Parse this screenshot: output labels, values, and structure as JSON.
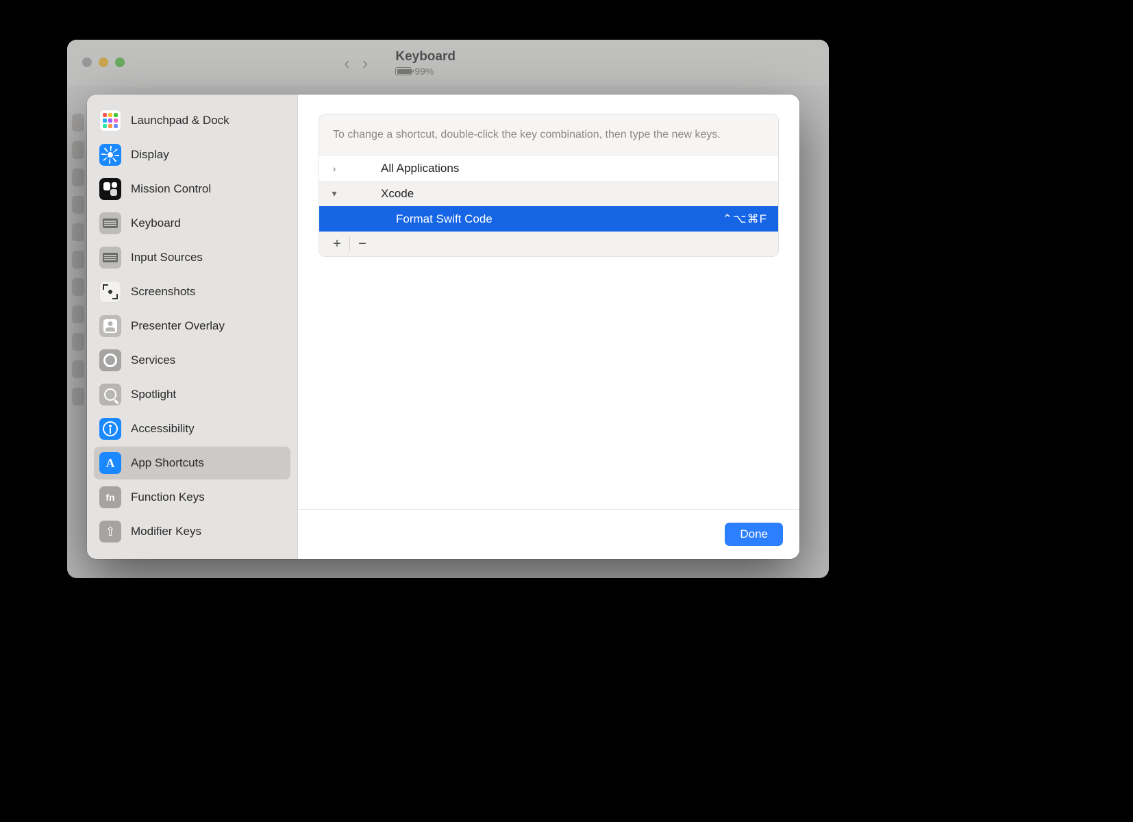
{
  "bg_window": {
    "title": "Keyboard",
    "battery_percent": "99%"
  },
  "sidebar": {
    "items": [
      {
        "label": "Launchpad & Dock",
        "icon": "launchpad-icon"
      },
      {
        "label": "Display",
        "icon": "display-icon"
      },
      {
        "label": "Mission Control",
        "icon": "mission-control-icon"
      },
      {
        "label": "Keyboard",
        "icon": "keyboard-icon"
      },
      {
        "label": "Input Sources",
        "icon": "input-sources-icon"
      },
      {
        "label": "Screenshots",
        "icon": "screenshots-icon"
      },
      {
        "label": "Presenter Overlay",
        "icon": "presenter-overlay-icon"
      },
      {
        "label": "Services",
        "icon": "services-icon"
      },
      {
        "label": "Spotlight",
        "icon": "spotlight-icon"
      },
      {
        "label": "Accessibility",
        "icon": "accessibility-icon"
      },
      {
        "label": "App Shortcuts",
        "icon": "app-shortcuts-icon",
        "selected": true
      },
      {
        "label": "Function Keys",
        "icon": "function-keys-icon"
      },
      {
        "label": "Modifier Keys",
        "icon": "modifier-keys-icon"
      }
    ]
  },
  "main": {
    "hint": "To change a shortcut, double-click the key combination, then type the new keys.",
    "tree": [
      {
        "label": "All Applications",
        "expanded": false,
        "level": 0
      },
      {
        "label": "Xcode",
        "expanded": true,
        "level": 0
      },
      {
        "label": "Format Swift Code",
        "shortcut": "⌃⌥⌘F",
        "level": 1,
        "selected": true
      }
    ],
    "add_label": "+",
    "remove_label": "−",
    "done_label": "Done"
  }
}
